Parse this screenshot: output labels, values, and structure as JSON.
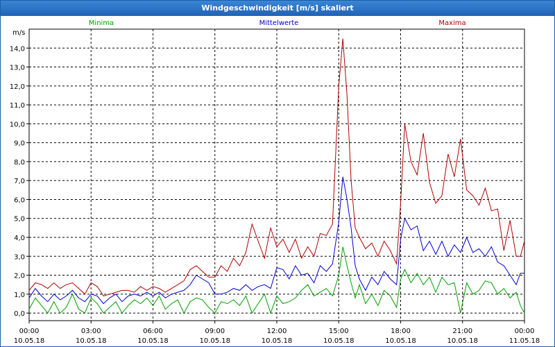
{
  "window": {
    "title": "Windgeschwindigkeit [m/s] skaliert"
  },
  "chart_data": {
    "type": "line",
    "title": "Windgeschwindigkeit [m/s] skaliert",
    "ylabel": "m/s",
    "xlabel": "",
    "ylim": [
      -0.4,
      15.0
    ],
    "xlim": [
      0,
      24
    ],
    "grid": true,
    "legend_placement": "top",
    "y_ticks": [
      "0,0",
      "1,0",
      "2,0",
      "3,0",
      "4,0",
      "5,0",
      "6,0",
      "7,0",
      "8,0",
      "9,0",
      "10,0",
      "11,0",
      "12,0",
      "13,0",
      "14,0"
    ],
    "x_ticks": [
      {
        "time": "00:00",
        "date": "10.05.18"
      },
      {
        "time": "03:00",
        "date": "10.05.18"
      },
      {
        "time": "06:00",
        "date": "10.05.18"
      },
      {
        "time": "09:00",
        "date": "10.05.18"
      },
      {
        "time": "12:00",
        "date": "10.05.18"
      },
      {
        "time": "15:00",
        "date": "10.05.18"
      },
      {
        "time": "18:00",
        "date": "10.05.18"
      },
      {
        "time": "21:00",
        "date": "10.05.18"
      },
      {
        "time": "00:00",
        "date": "11.05.18"
      }
    ],
    "series": [
      {
        "name": "Minima",
        "color": "#00a000",
        "points": [
          [
            0,
            0.2
          ],
          [
            0.3,
            0.8
          ],
          [
            0.6,
            0.4
          ],
          [
            0.9,
            0.0
          ],
          [
            1.2,
            0.6
          ],
          [
            1.5,
            0.0
          ],
          [
            1.8,
            0.3
          ],
          [
            2.1,
            1.0
          ],
          [
            2.4,
            0.2
          ],
          [
            2.7,
            0.0
          ],
          [
            3.0,
            0.8
          ],
          [
            3.3,
            0.5
          ],
          [
            3.6,
            0.0
          ],
          [
            3.9,
            0.3
          ],
          [
            4.2,
            0.6
          ],
          [
            4.5,
            0.0
          ],
          [
            4.8,
            0.4
          ],
          [
            5.1,
            0.7
          ],
          [
            5.4,
            0.5
          ],
          [
            5.7,
            0.8
          ],
          [
            6.0,
            0.4
          ],
          [
            6.3,
            0.9
          ],
          [
            6.6,
            0.2
          ],
          [
            6.9,
            0.5
          ],
          [
            7.2,
            0.7
          ],
          [
            7.5,
            0.0
          ],
          [
            7.8,
            0.6
          ],
          [
            8.1,
            0.8
          ],
          [
            8.4,
            0.7
          ],
          [
            8.7,
            0.3
          ],
          [
            9.0,
            0.0
          ],
          [
            9.3,
            0.6
          ],
          [
            9.6,
            0.5
          ],
          [
            9.9,
            0.7
          ],
          [
            10.2,
            0.4
          ],
          [
            10.5,
            0.9
          ],
          [
            10.8,
            0.0
          ],
          [
            11.1,
            0.5
          ],
          [
            11.4,
            1.0
          ],
          [
            11.7,
            0.0
          ],
          [
            12.0,
            0.9
          ],
          [
            12.3,
            0.5
          ],
          [
            12.6,
            0.6
          ],
          [
            12.9,
            0.8
          ],
          [
            13.2,
            1.2
          ],
          [
            13.5,
            1.5
          ],
          [
            13.8,
            0.9
          ],
          [
            14.1,
            1.1
          ],
          [
            14.4,
            1.3
          ],
          [
            14.7,
            0.9
          ],
          [
            15.0,
            2.0
          ],
          [
            15.2,
            3.5
          ],
          [
            15.4,
            2.5
          ],
          [
            15.6,
            1.6
          ],
          [
            15.8,
            0.8
          ],
          [
            16.0,
            1.5
          ],
          [
            16.3,
            0.5
          ],
          [
            16.6,
            1.0
          ],
          [
            16.9,
            0.4
          ],
          [
            17.2,
            1.2
          ],
          [
            17.5,
            0.9
          ],
          [
            17.8,
            0.3
          ],
          [
            18.0,
            1.8
          ],
          [
            18.2,
            2.3
          ],
          [
            18.5,
            1.6
          ],
          [
            18.8,
            2.1
          ],
          [
            19.1,
            1.5
          ],
          [
            19.4,
            1.9
          ],
          [
            19.7,
            1.1
          ],
          [
            20.0,
            1.9
          ],
          [
            20.3,
            1.5
          ],
          [
            20.6,
            1.6
          ],
          [
            20.9,
            0.0
          ],
          [
            21.2,
            1.6
          ],
          [
            21.5,
            1.0
          ],
          [
            21.8,
            1.2
          ],
          [
            22.1,
            1.7
          ],
          [
            22.4,
            1.6
          ],
          [
            22.7,
            1.0
          ],
          [
            23.0,
            1.3
          ],
          [
            23.3,
            0.8
          ],
          [
            23.6,
            1.1
          ],
          [
            23.8,
            0.4
          ],
          [
            24.0,
            0.0
          ]
        ]
      },
      {
        "name": "Mittelwerte",
        "color": "#0000d0",
        "points": [
          [
            0,
            0.8
          ],
          [
            0.3,
            1.3
          ],
          [
            0.6,
            0.9
          ],
          [
            0.9,
            0.6
          ],
          [
            1.2,
            1.0
          ],
          [
            1.5,
            0.7
          ],
          [
            1.8,
            0.9
          ],
          [
            2.1,
            1.2
          ],
          [
            2.4,
            0.8
          ],
          [
            2.7,
            0.6
          ],
          [
            3.0,
            1.0
          ],
          [
            3.3,
            0.9
          ],
          [
            3.6,
            0.5
          ],
          [
            3.9,
            0.8
          ],
          [
            4.2,
            1.0
          ],
          [
            4.5,
            0.6
          ],
          [
            4.8,
            0.9
          ],
          [
            5.1,
            1.0
          ],
          [
            5.4,
            0.9
          ],
          [
            5.7,
            1.1
          ],
          [
            6.0,
            0.9
          ],
          [
            6.3,
            1.1
          ],
          [
            6.6,
            0.8
          ],
          [
            6.9,
            1.0
          ],
          [
            7.2,
            1.1
          ],
          [
            7.5,
            1.2
          ],
          [
            7.8,
            1.5
          ],
          [
            8.1,
            2.0
          ],
          [
            8.4,
            1.8
          ],
          [
            8.7,
            1.6
          ],
          [
            9.0,
            1.0
          ],
          [
            9.3,
            1.0
          ],
          [
            9.6,
            1.1
          ],
          [
            9.9,
            1.3
          ],
          [
            10.2,
            1.2
          ],
          [
            10.5,
            1.5
          ],
          [
            10.8,
            1.2
          ],
          [
            11.1,
            1.4
          ],
          [
            11.4,
            1.5
          ],
          [
            11.7,
            1.3
          ],
          [
            12.0,
            2.4
          ],
          [
            12.3,
            2.3
          ],
          [
            12.6,
            1.8
          ],
          [
            12.9,
            2.5
          ],
          [
            13.2,
            2.0
          ],
          [
            13.5,
            2.1
          ],
          [
            13.8,
            1.6
          ],
          [
            14.1,
            2.5
          ],
          [
            14.4,
            2.2
          ],
          [
            14.7,
            2.6
          ],
          [
            15.0,
            4.8
          ],
          [
            15.2,
            7.2
          ],
          [
            15.4,
            6.0
          ],
          [
            15.6,
            4.5
          ],
          [
            15.8,
            2.5
          ],
          [
            16.0,
            1.8
          ],
          [
            16.3,
            1.2
          ],
          [
            16.6,
            1.9
          ],
          [
            16.9,
            1.5
          ],
          [
            17.2,
            2.2
          ],
          [
            17.5,
            1.8
          ],
          [
            17.8,
            1.5
          ],
          [
            18.0,
            3.9
          ],
          [
            18.2,
            5.0
          ],
          [
            18.5,
            4.4
          ],
          [
            18.8,
            4.6
          ],
          [
            19.1,
            3.3
          ],
          [
            19.4,
            3.8
          ],
          [
            19.7,
            3.1
          ],
          [
            20.0,
            3.8
          ],
          [
            20.3,
            3.0
          ],
          [
            20.6,
            3.6
          ],
          [
            20.9,
            3.2
          ],
          [
            21.2,
            4.0
          ],
          [
            21.5,
            3.2
          ],
          [
            21.8,
            3.4
          ],
          [
            22.1,
            3.0
          ],
          [
            22.4,
            3.5
          ],
          [
            22.7,
            2.7
          ],
          [
            23.0,
            2.5
          ],
          [
            23.3,
            2.0
          ],
          [
            23.6,
            1.5
          ],
          [
            23.8,
            2.1
          ],
          [
            24.0,
            2.1
          ]
        ]
      },
      {
        "name": "Maxima",
        "color": "#b00000",
        "points": [
          [
            0,
            1.2
          ],
          [
            0.3,
            1.6
          ],
          [
            0.6,
            1.5
          ],
          [
            0.9,
            1.3
          ],
          [
            1.2,
            1.6
          ],
          [
            1.5,
            1.3
          ],
          [
            1.8,
            1.5
          ],
          [
            2.1,
            1.6
          ],
          [
            2.4,
            1.3
          ],
          [
            2.7,
            1.0
          ],
          [
            3.0,
            1.6
          ],
          [
            3.3,
            1.4
          ],
          [
            3.6,
            0.9
          ],
          [
            3.9,
            1.0
          ],
          [
            4.2,
            1.1
          ],
          [
            4.5,
            1.2
          ],
          [
            4.8,
            1.2
          ],
          [
            5.1,
            1.1
          ],
          [
            5.4,
            1.4
          ],
          [
            5.7,
            1.2
          ],
          [
            6.0,
            1.4
          ],
          [
            6.3,
            1.3
          ],
          [
            6.6,
            1.1
          ],
          [
            6.9,
            1.3
          ],
          [
            7.2,
            1.5
          ],
          [
            7.5,
            1.7
          ],
          [
            7.8,
            2.3
          ],
          [
            8.1,
            2.5
          ],
          [
            8.4,
            2.2
          ],
          [
            8.7,
            1.9
          ],
          [
            9.0,
            1.9
          ],
          [
            9.3,
            2.5
          ],
          [
            9.6,
            2.2
          ],
          [
            9.9,
            2.9
          ],
          [
            10.2,
            2.5
          ],
          [
            10.5,
            3.2
          ],
          [
            10.8,
            4.7
          ],
          [
            11.1,
            3.8
          ],
          [
            11.4,
            2.9
          ],
          [
            11.7,
            4.5
          ],
          [
            12.0,
            3.5
          ],
          [
            12.3,
            3.9
          ],
          [
            12.6,
            3.2
          ],
          [
            12.9,
            3.9
          ],
          [
            13.2,
            2.9
          ],
          [
            13.5,
            3.5
          ],
          [
            13.8,
            3.0
          ],
          [
            14.1,
            4.2
          ],
          [
            14.4,
            4.1
          ],
          [
            14.7,
            4.7
          ],
          [
            15.0,
            12.0
          ],
          [
            15.2,
            14.5
          ],
          [
            15.4,
            11.5
          ],
          [
            15.6,
            7.0
          ],
          [
            15.8,
            4.5
          ],
          [
            16.0,
            4.0
          ],
          [
            16.3,
            3.4
          ],
          [
            16.6,
            3.7
          ],
          [
            16.9,
            3.0
          ],
          [
            17.2,
            3.8
          ],
          [
            17.5,
            3.3
          ],
          [
            17.8,
            2.6
          ],
          [
            18.0,
            5.8
          ],
          [
            18.2,
            10.0
          ],
          [
            18.5,
            8.0
          ],
          [
            18.8,
            7.3
          ],
          [
            19.1,
            9.5
          ],
          [
            19.4,
            6.9
          ],
          [
            19.7,
            5.8
          ],
          [
            20.0,
            6.2
          ],
          [
            20.3,
            8.4
          ],
          [
            20.6,
            7.2
          ],
          [
            20.9,
            9.2
          ],
          [
            21.2,
            6.5
          ],
          [
            21.5,
            6.2
          ],
          [
            21.8,
            5.7
          ],
          [
            22.1,
            6.6
          ],
          [
            22.4,
            5.4
          ],
          [
            22.7,
            5.5
          ],
          [
            23.0,
            3.3
          ],
          [
            23.3,
            4.9
          ],
          [
            23.6,
            3.0
          ],
          [
            23.8,
            3.0
          ],
          [
            24.0,
            3.8
          ]
        ]
      }
    ]
  }
}
